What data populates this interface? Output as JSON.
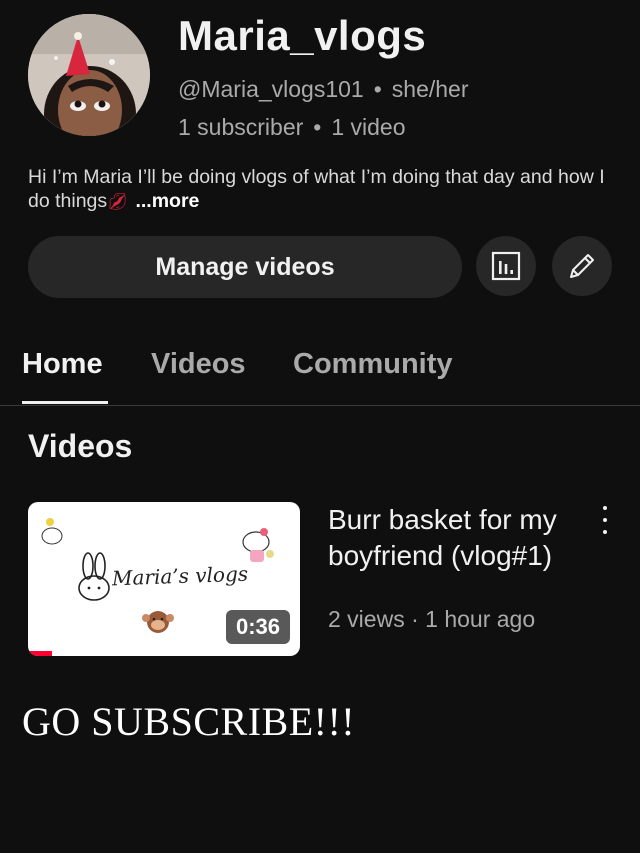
{
  "channel": {
    "name": "Maria_vlogs",
    "handle": "@Maria_vlogs101",
    "pronouns": "she/her",
    "subscribers": "1 subscriber",
    "video_count": "1 video",
    "separator": "•",
    "description": "Hi I’m Maria I’ll be doing vlogs of what I’m doing that day and how I do things",
    "description_more": "...more"
  },
  "actions": {
    "manage_label": "Manage videos",
    "analytics_icon": "analytics-icon",
    "edit_icon": "pencil-icon"
  },
  "tabs": [
    {
      "label": "Home",
      "active": true
    },
    {
      "label": "Videos",
      "active": false
    },
    {
      "label": "Community",
      "active": false
    }
  ],
  "section": {
    "title": "Videos"
  },
  "video": {
    "thumbnail_text": "Maria’s vlogs",
    "duration": "0:36",
    "title": "Burr basket for my boyfriend (vlog#1)",
    "views": "2 views",
    "age": "1 hour ago",
    "meta_separator": "·",
    "watch_progress": 0.09,
    "menu_icon": "more-vert-icon"
  },
  "banner": "GO SUBSCRIBE!!!",
  "colors": {
    "background": "#0f0f0f",
    "button_bg": "#272727",
    "secondary_text": "#aaaaaa",
    "progress": "#ff0033"
  }
}
